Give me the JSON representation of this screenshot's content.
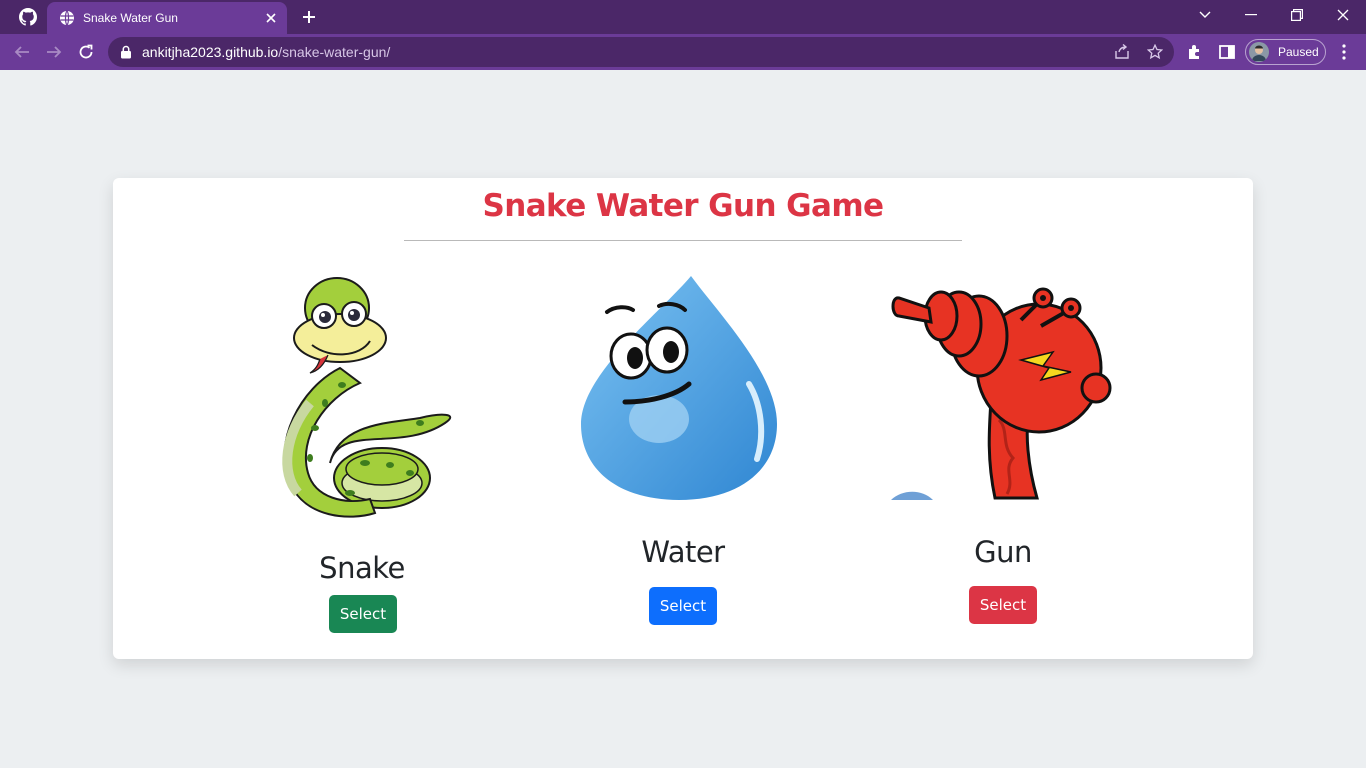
{
  "browser": {
    "tab": {
      "title": "Snake Water Gun"
    },
    "address": {
      "host": "ankitjha2023.github.io",
      "path": "/snake-water-gun/"
    },
    "profile": {
      "label": "Paused"
    }
  },
  "page": {
    "title": "Snake Water Gun Game",
    "colors": {
      "title": "#dc3545",
      "snake_button": "#198754",
      "water_button": "#0d6efd",
      "gun_button": "#dc3545"
    },
    "choices": [
      {
        "name": "Snake",
        "button_label": "Select",
        "image": "snake-image"
      },
      {
        "name": "Water",
        "button_label": "Select",
        "image": "water-image"
      },
      {
        "name": "Gun",
        "button_label": "Select",
        "image": "gun-image"
      }
    ]
  }
}
